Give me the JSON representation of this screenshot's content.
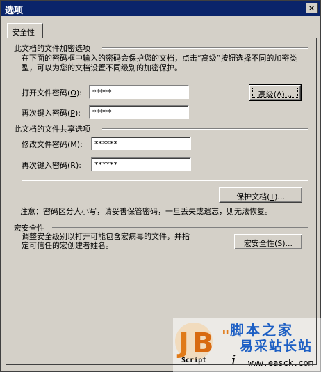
{
  "window": {
    "title": "选项",
    "close_glyph": "✕"
  },
  "tab": {
    "label": "安全性"
  },
  "encrypt": {
    "heading": "此文档的文件加密选项",
    "description": "在下面的密码框中输入的密码会保护您的文档，点击“高级”按钮选择不同的加密类型，可以为您的文档设置不同级别的加密保护。",
    "open_label": "打开文件密码",
    "open_key": "O",
    "open_value": "*****",
    "reenter_label": "再次键入密码",
    "reenter_key": "P",
    "reenter_value": "*****",
    "advanced_button": "高级",
    "advanced_key": "A"
  },
  "share": {
    "heading": "此文档的文件共享选项",
    "modify_label": "修改文件密码",
    "modify_key": "M",
    "modify_value": "******",
    "reenter_label": "再次键入密码",
    "reenter_key": "R",
    "reenter_value": "******",
    "protect_button": "保护文档",
    "protect_key": "T"
  },
  "note": "注意：密码区分大小写，请妥善保管密码，一旦丢失或遗忘，则无法恢复。",
  "macro": {
    "heading": "宏安全性",
    "description": "调整安全级别以打开可能包含宏病毒的文件，并指定可信任的宏创建者姓名。",
    "button": "宏安全性",
    "button_key": "S"
  },
  "watermark": {
    "brand_cn": "脚本之家",
    "site_cn": "易采站长站",
    "url": "www.easck.com",
    "script_text": "Script"
  },
  "colors": {
    "titlebar": "#0a246a",
    "face": "#d4d0c8",
    "logo_orange": "#e07a18",
    "logo_blue": "#1d5fc4"
  }
}
